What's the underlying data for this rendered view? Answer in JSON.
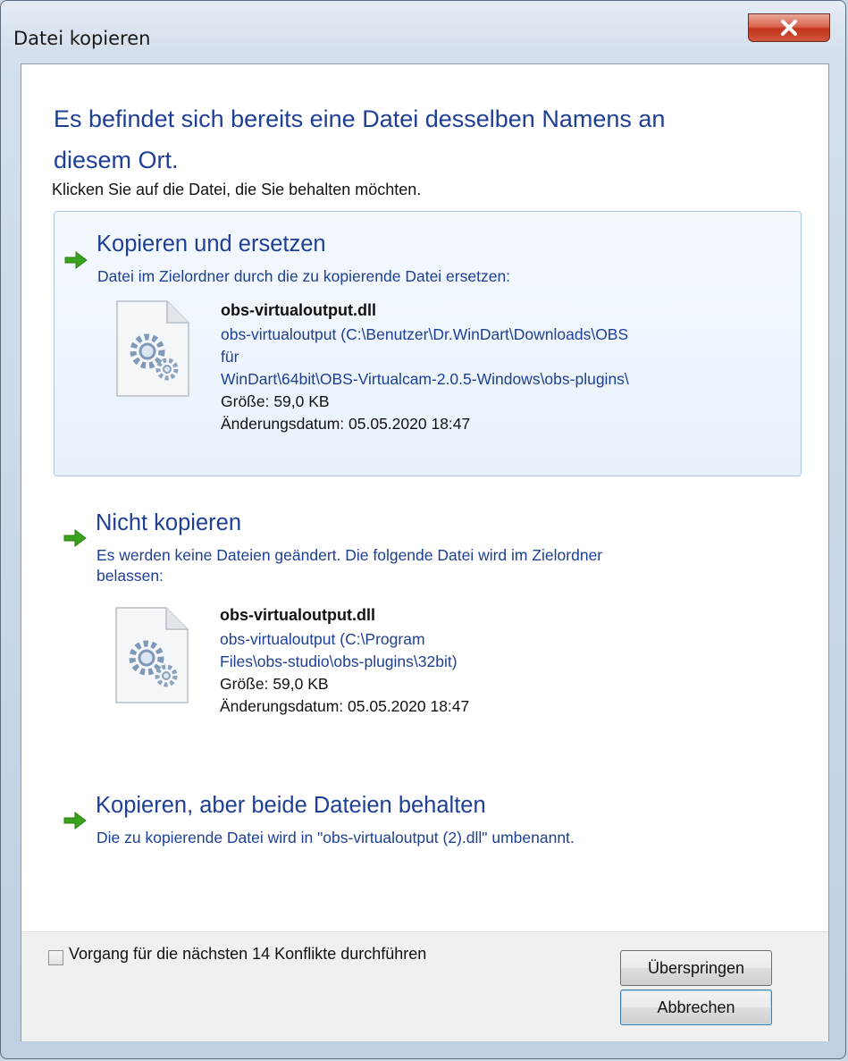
{
  "window": {
    "title": "Datei kopieren",
    "close_icon": "close-icon"
  },
  "dialog": {
    "heading_line1": "Es befindet sich bereits eine Datei desselben Namens an",
    "heading_line2": "diesem Ort.",
    "subheading": "Klicken Sie auf die Datei, die Sie behalten möchten."
  },
  "options": [
    {
      "title": "Kopieren und ersetzen",
      "description_lines": [
        "Datei im Zielordner durch die zu kopierende Datei ersetzen:"
      ],
      "file": {
        "name": "obs-virtualoutput.dll",
        "path_lines": [
          "obs-virtualoutput (C:\\Benutzer\\Dr.WinDart\\Downloads\\OBS",
          "für",
          "WinDart\\64bit\\OBS-Virtualcam-2.0.5-Windows\\obs-plugins\\"
        ],
        "size": "Größe: 59,0 KB",
        "modified": "Änderungsdatum: 05.05.2020 18:47",
        "icon": "dll-file-icon"
      }
    },
    {
      "title": "Nicht kopieren",
      "description_lines": [
        "Es werden keine Dateien geändert. Die folgende Datei wird im Zielordner",
        "belassen:"
      ],
      "file": {
        "name": "obs-virtualoutput.dll",
        "path_lines": [
          "obs-virtualoutput (C:\\Program",
          "Files\\obs-studio\\obs-plugins\\32bit)"
        ],
        "size": "Größe: 59,0 KB",
        "modified": "Änderungsdatum: 05.05.2020 18:47",
        "icon": "dll-file-icon"
      }
    },
    {
      "title": "Kopieren, aber beide Dateien behalten",
      "description_lines": [
        "Die zu kopierende Datei wird in \"obs-virtualoutput (2).dll\" umbenannt."
      ]
    }
  ],
  "footer": {
    "checkbox_label": "Vorgang für die nächsten 14 Konflikte durchführen",
    "checkbox_checked": false,
    "skip_label": "Überspringen",
    "cancel_label": "Abbrechen"
  },
  "colors": {
    "link_blue": "#1e3f94",
    "arrow_green": "#3aa21c",
    "close_red": "#c2341c"
  }
}
